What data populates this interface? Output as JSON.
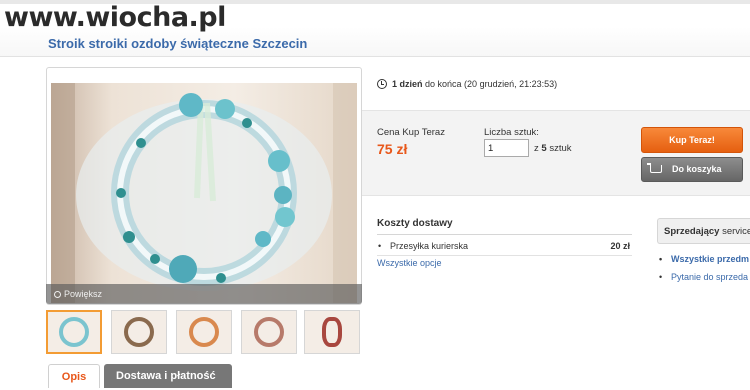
{
  "watermark": "www.wiocha.pl",
  "title": "Stroik stroiki ozdoby świąteczne Szczecin",
  "gallery": {
    "zoom_label": "Powiększ",
    "thumbnail_count": 5
  },
  "tabs": [
    {
      "label": "Opis"
    },
    {
      "label": "Dostawa i płatność"
    }
  ],
  "timer": {
    "remaining": "1 dzień",
    "suffix": "do końca (20 grudzień, 21:23:53)"
  },
  "buy": {
    "price_label": "Cena Kup Teraz",
    "price": "75 zł",
    "qty_label": "Liczba sztuk:",
    "qty_value": "1",
    "qty_of_prefix": "z",
    "qty_of_bold": "5",
    "qty_of_suffix": "sztuk",
    "buy_now_label": "Kup Teraz!",
    "cart_label": "Do koszyka"
  },
  "shipping": {
    "title": "Koszty dostawy",
    "rows": [
      {
        "name": "Przesyłka kurierska",
        "cost": "20 zł"
      }
    ],
    "all_options": "Wszystkie opcje"
  },
  "seller": {
    "label": "Sprzedający",
    "name": "service",
    "links": [
      "Wszystkie przedm",
      "Pytanie do sprzeda"
    ]
  },
  "colors": {
    "accent": "#e8571a",
    "link": "#3b6aaa",
    "buy_button": "#f37b2b",
    "cart_button": "#777777"
  }
}
